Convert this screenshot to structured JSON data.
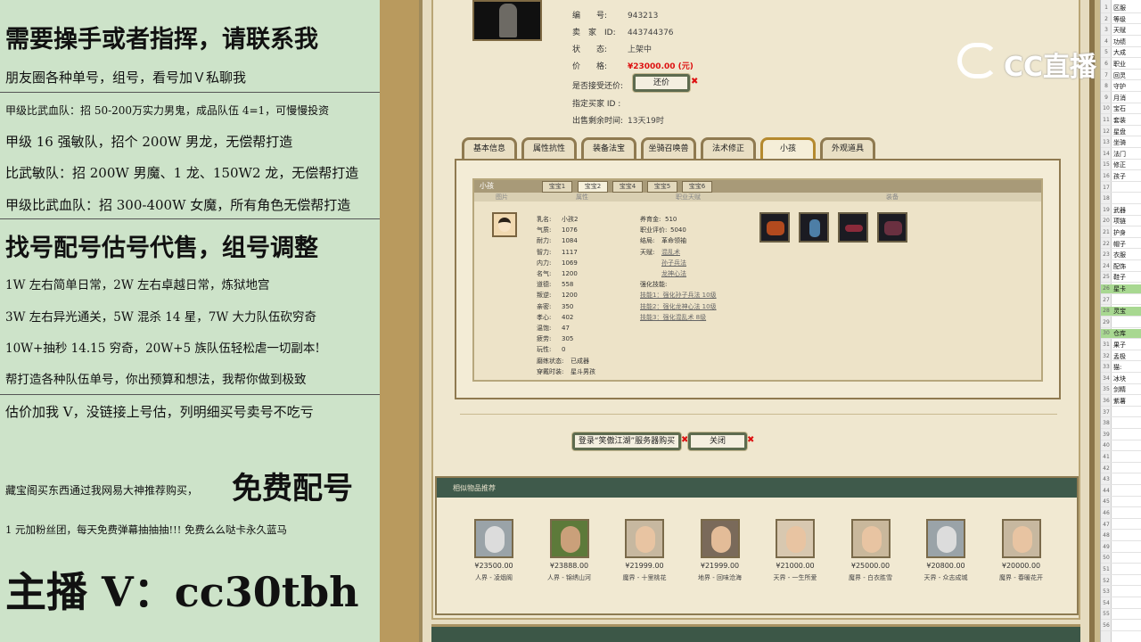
{
  "overlay": {
    "line1": "需要操手或者指挥，请联系我",
    "line2": "朋友圈各种单号，组号，看号加Ｖ私聊我",
    "line3": "甲级比武血队：招 50-200万实力男鬼，成品队伍 4=1，可慢慢投资",
    "line4": "甲级 16 强敏队，招个 200W 男龙，无偿帮打造",
    "line5": "比武敏队：招 200W 男魔、1 龙、150W2 龙，无偿帮打造",
    "line6": "甲级比武血队：招 300-400W 女魔，所有角色无偿帮打造",
    "line7": "找号配号估号代售，组号调整",
    "line8": "1W 左右简单日常，2W 左右卓越日常，炼狱地宫",
    "line9": "3W 左右异光通关，5W 混杀 14 星，7W 大力队伍砍穷奇",
    "line10": "10W+抽秒 14.15 穷奇，20W+5 族队伍轻松虐一切副本!",
    "line11": "帮打造各种队伍单号，你出预算和想法，我帮你做到极致",
    "line12": "估价加我 V，没链接上号估，列明细买号卖号不吃亏",
    "line13a": "藏宝阁买东西通过我网易大神推荐购买，",
    "line13b": "免费配号",
    "line14": "1 元加粉丝团，每天免费弹幕抽抽抽!!! 免费么么哒卡永久蓝马",
    "line15": "主播 V：cc30tbh"
  },
  "item": {
    "id_label": "编　　号:",
    "id_value": "943213",
    "seller_label": "卖　家　ID:",
    "seller_value": "443744376",
    "status_label": "状　　态:",
    "status_value": "上架中",
    "price_label": "价　　格:",
    "price_value": "¥23000.00 (元)",
    "counter_label": "是否接受还价:",
    "counter_button": "还价",
    "buyer_label": "指定买家 ID :",
    "remain_label": "出售剩余时间:",
    "remain_value": "13天19时"
  },
  "tabs": [
    "基本信息",
    "属性抗性",
    "装备法宝",
    "坐骑召唤兽",
    "法术修正",
    "小孩",
    "外观道具"
  ],
  "active_tab": "小孩",
  "child": {
    "title": "小孩",
    "subtabs": [
      "宝宝1",
      "宝宝2",
      "宝宝4",
      "宝宝5",
      "宝宝6"
    ],
    "columns": [
      "图片",
      "属性",
      "职业天赋",
      "装备"
    ],
    "stats": [
      {
        "k": "乳名:",
        "v": "小孩2"
      },
      {
        "k": "气质:",
        "v": "1076"
      },
      {
        "k": "耐力:",
        "v": "1084"
      },
      {
        "k": "智力:",
        "v": "1117"
      },
      {
        "k": "内力:",
        "v": "1069"
      },
      {
        "k": "名气:",
        "v": "1200"
      },
      {
        "k": "道德:",
        "v": "558"
      },
      {
        "k": "叛逆:",
        "v": "1200"
      },
      {
        "k": "亲密:",
        "v": "350"
      },
      {
        "k": "孝心:",
        "v": "402"
      },
      {
        "k": "温饱:",
        "v": "47"
      },
      {
        "k": "疲劳:",
        "v": "305"
      },
      {
        "k": "玩性:",
        "v": "0"
      },
      {
        "k": "磨练状态:",
        "v": "已成器"
      },
      {
        "k": "穿戴时装:",
        "v": "星斗男孩"
      }
    ],
    "talent": {
      "raise_label": "养育金:",
      "raise_value": "510",
      "eval_label": "职业评价:",
      "eval_value": "5040",
      "ending_label": "结局:",
      "ending_value": "革命领袖",
      "skill_label": "天赋:",
      "skills": [
        "混乱术",
        "孙子兵法",
        "龙神心法"
      ],
      "enhance_label": "强化技能:",
      "enhances": [
        "技能1：强化孙子兵法 10级",
        "技能2：强化龙神心法 10级",
        "技能3：强化混乱术 8级"
      ]
    },
    "equip_icons": [
      "helmet-icon",
      "vase-icon",
      "scroll-icon",
      "robe-icon"
    ]
  },
  "actions": {
    "login_buy": "登录“笑傲江湖”服务器购买",
    "close": "关闭"
  },
  "similar": {
    "title": "相似物品推荐",
    "items": [
      {
        "price": "¥23500.00",
        "server": "人界 - 凌烟阁"
      },
      {
        "price": "¥23888.00",
        "server": "人界 - 锦绣山河"
      },
      {
        "price": "¥21999.00",
        "server": "魔界 - 十里桃花"
      },
      {
        "price": "¥21999.00",
        "server": "地界 - 回味沧海"
      },
      {
        "price": "¥21000.00",
        "server": "天界 - 一生所爱"
      },
      {
        "price": "¥25000.00",
        "server": "魔界 - 白衣胜雪"
      },
      {
        "price": "¥20800.00",
        "server": "天界 - 众志成城"
      },
      {
        "price": "¥20000.00",
        "server": "魔界 - 春暖花开"
      }
    ]
  },
  "sheet": {
    "rows": [
      {
        "n": "1",
        "c": "区服"
      },
      {
        "n": "2",
        "c": "等级"
      },
      {
        "n": "3",
        "c": "天赋"
      },
      {
        "n": "4",
        "c": "功绩"
      },
      {
        "n": "5",
        "c": "大成"
      },
      {
        "n": "6",
        "c": "职业"
      },
      {
        "n": "7",
        "c": "回灵"
      },
      {
        "n": "8",
        "c": "守护"
      },
      {
        "n": "9",
        "c": "月消"
      },
      {
        "n": "10",
        "c": "宝石"
      },
      {
        "n": "11",
        "c": "套装"
      },
      {
        "n": "12",
        "c": "星盘"
      },
      {
        "n": "13",
        "c": "坐骑"
      },
      {
        "n": "14",
        "c": "法门"
      },
      {
        "n": "15",
        "c": "修正"
      },
      {
        "n": "16",
        "c": "孩子"
      },
      {
        "n": "17",
        "c": ""
      },
      {
        "n": "18",
        "c": ""
      },
      {
        "n": "19",
        "c": "武器"
      },
      {
        "n": "20",
        "c": "项链"
      },
      {
        "n": "21",
        "c": "护身"
      },
      {
        "n": "22",
        "c": "帽子"
      },
      {
        "n": "23",
        "c": "衣服"
      },
      {
        "n": "24",
        "c": "配饰"
      },
      {
        "n": "25",
        "c": "鞋子"
      },
      {
        "n": "26",
        "c": "星卡"
      },
      {
        "n": "27",
        "c": ""
      },
      {
        "n": "28",
        "c": "灵宝"
      },
      {
        "n": "29",
        "c": ""
      },
      {
        "n": "30",
        "c": "仓库"
      },
      {
        "n": "31",
        "c": "果子"
      },
      {
        "n": "32",
        "c": "孟极"
      },
      {
        "n": "33",
        "c": "猫:"
      },
      {
        "n": "34",
        "c": "冰块"
      },
      {
        "n": "35",
        "c": "剑精"
      },
      {
        "n": "36",
        "c": "紫薯"
      },
      {
        "n": "37",
        "c": ""
      },
      {
        "n": "38",
        "c": ""
      },
      {
        "n": "39",
        "c": ""
      },
      {
        "n": "40",
        "c": ""
      },
      {
        "n": "41",
        "c": ""
      },
      {
        "n": "42",
        "c": ""
      },
      {
        "n": "43",
        "c": ""
      },
      {
        "n": "44",
        "c": ""
      },
      {
        "n": "45",
        "c": ""
      },
      {
        "n": "46",
        "c": ""
      },
      {
        "n": "47",
        "c": ""
      },
      {
        "n": "48",
        "c": ""
      },
      {
        "n": "49",
        "c": ""
      },
      {
        "n": "50",
        "c": ""
      },
      {
        "n": "51",
        "c": ""
      },
      {
        "n": "52",
        "c": ""
      },
      {
        "n": "53",
        "c": ""
      },
      {
        "n": "54",
        "c": ""
      },
      {
        "n": "55",
        "c": ""
      },
      {
        "n": "56",
        "c": ""
      }
    ],
    "green_rows": [
      "26",
      "28",
      "30"
    ]
  },
  "watermark": "CC直播",
  "colors": {
    "price": "#dd1111",
    "accent_green": "#3f5a4b",
    "tab_active": "#b58a2e"
  }
}
